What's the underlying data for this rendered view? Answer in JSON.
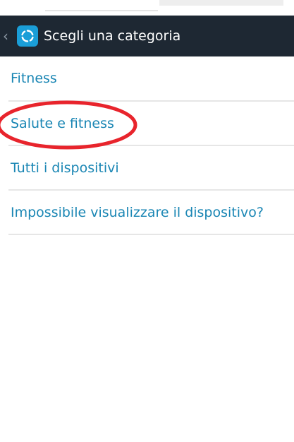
{
  "action_bar": {
    "back_icon": "chevron-left-icon",
    "app_icon": "sync-icon",
    "title": "Scegli una categoria",
    "background_color": "#1e2833",
    "app_icon_color": "#1a9ed8"
  },
  "categories": {
    "items": [
      {
        "label": "Fitness"
      },
      {
        "label": "Salute e fitness"
      },
      {
        "label": "Tutti i dispositivi"
      },
      {
        "label": "Impossibile visualizzare il dispositivo?"
      }
    ],
    "text_color": "#1a86b4",
    "divider_color": "#e6e6e6"
  },
  "annotation": {
    "shape": "ellipse",
    "color": "#e8242c",
    "highlights": "Salute e fitness"
  }
}
